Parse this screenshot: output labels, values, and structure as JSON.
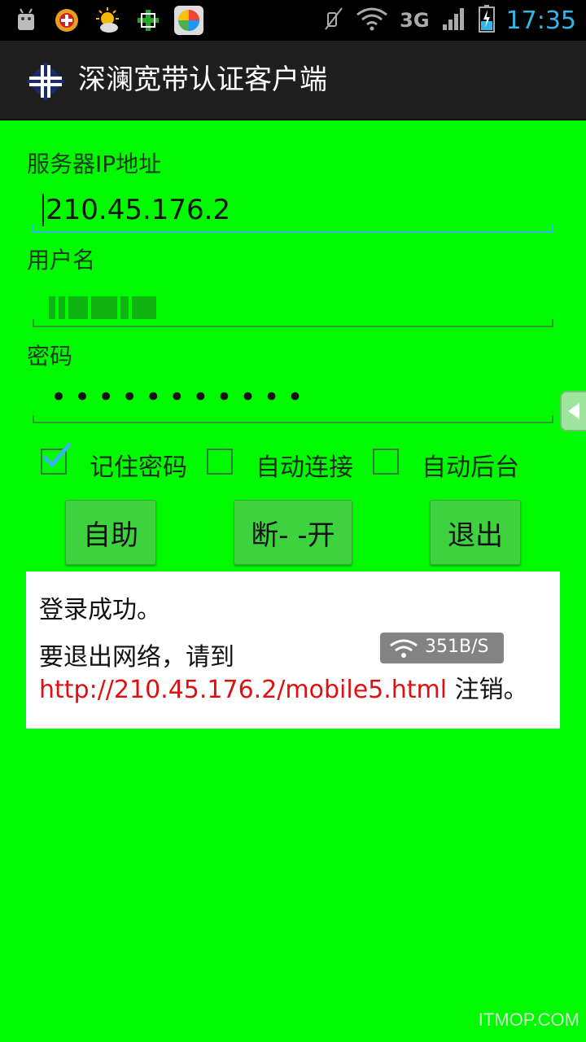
{
  "status_bar": {
    "time": "17:35",
    "network_type": "3G",
    "icons": [
      "android-debug-icon",
      "app-icon-red",
      "weather-icon",
      "app-icon-green",
      "app-icon-tiles",
      "mute-icon",
      "wifi-icon",
      "signal-icon",
      "battery-charging-icon"
    ]
  },
  "action_bar": {
    "title": "深澜宽带认证客户端",
    "logo_icon": "cross-logo-icon"
  },
  "form": {
    "server_ip_label": "服务器IP地址",
    "server_ip_value": "210.45.176.2",
    "username_label": "用户名",
    "password_label": "密码",
    "password_mask": "•••••••••••"
  },
  "options": {
    "remember_password": {
      "label": "记住密码",
      "checked": true
    },
    "auto_connect": {
      "label": "自动连接",
      "checked": false
    },
    "auto_background": {
      "label": "自动后台",
      "checked": false
    }
  },
  "buttons": {
    "self_service": "自助",
    "disconnect": "断- -开",
    "exit": "退出"
  },
  "message": {
    "status": "登录成功。",
    "logout_prefix": "要退出网络，请到 ",
    "logout_link": "http://210.45.176.2/mobile5.html",
    "logout_suffix": " 注销。"
  },
  "speed_overlay": {
    "text": "351B/S"
  },
  "watermark": "ITMOP.COM",
  "colors": {
    "background": "#00fb00",
    "link": "#e01010",
    "accent": "#33b5e5",
    "button": "#3fd23f"
  }
}
